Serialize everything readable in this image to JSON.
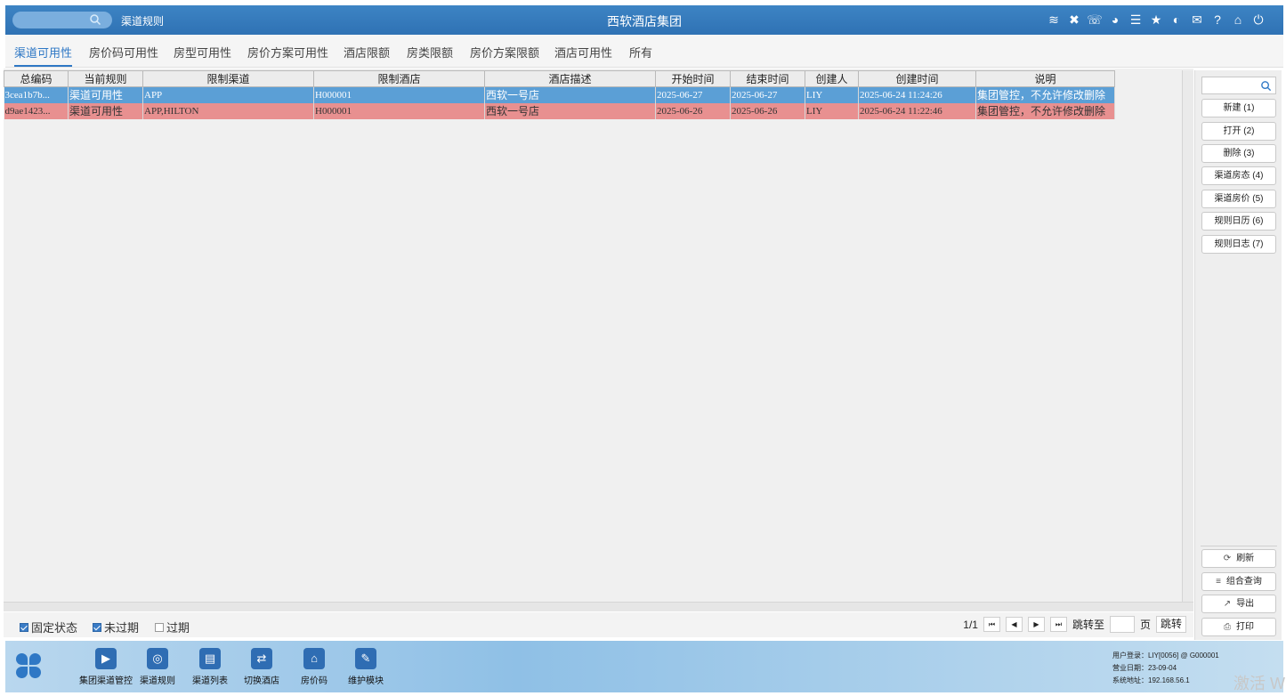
{
  "topbar": {
    "search_placeholder": "",
    "breadcrumb": "渠道规则",
    "system_title": "西软酒店集团",
    "icons": [
      "wifi-icon",
      "tools-icon",
      "phone-icon",
      "palette-icon",
      "menu-icon",
      "star-icon",
      "contrast-icon",
      "mail-icon",
      "help-icon",
      "home-icon",
      "power-icon"
    ]
  },
  "tabs": [
    "渠道可用性",
    "房价码可用性",
    "房型可用性",
    "房价方案可用性",
    "酒店限额",
    "房类限额",
    "房价方案限额",
    "酒店可用性",
    "所有"
  ],
  "grid": {
    "columns": [
      "总编码",
      "当前规则",
      "限制渠道",
      "限制酒店",
      "酒店描述",
      "开始时间",
      "结束时间",
      "创建人",
      "创建时间",
      "说明"
    ],
    "rows": [
      [
        "3cea1b7b...",
        "渠道可用性",
        "APP",
        "H000001",
        "西软一号店",
        "2025-06-27",
        "2025-06-27",
        "LIY",
        "2025-06-24 11:24:26",
        "集团管控，不允许修改删除"
      ],
      [
        "d9ae1423...",
        "渠道可用性",
        "APP,HILTON",
        "H000001",
        "西软一号店",
        "2025-06-26",
        "2025-06-26",
        "LIY",
        "2025-06-24 11:22:46",
        "集团管控，不允许修改删除"
      ]
    ]
  },
  "sidebar": {
    "search_placeholder": "",
    "buttons": [
      "新建 (1)",
      "打开 (2)",
      "删除 (3)",
      "渠道房态 (4)",
      "渠道房价 (5)",
      "规则日历 (6)",
      "规则日志 (7)"
    ],
    "bottom_buttons": [
      {
        "icon": "refresh-icon",
        "glyph": "⟳",
        "label": "刷新"
      },
      {
        "icon": "list-icon",
        "glyph": "≡",
        "label": "组合查询"
      },
      {
        "icon": "export-icon",
        "glyph": "↗",
        "label": "导出"
      },
      {
        "icon": "print-icon",
        "glyph": "⎙",
        "label": "打印"
      }
    ]
  },
  "filters": {
    "fixed_state": "固定状态",
    "not_expired": "未过期",
    "expired": "过期"
  },
  "pager": {
    "page": "1/1",
    "jump_to": "跳转至",
    "page_unit": "页",
    "jump": "跳转"
  },
  "modules": [
    "集团渠道管控",
    "渠道规则",
    "渠道列表",
    "切换酒店",
    "房价码",
    "维护模块"
  ],
  "info": {
    "user": "用户登录：LIY[0056] @ G000001",
    "biz_date": "营业日期：23-09-04",
    "address": "系统地址：192.168.56.1"
  },
  "watermark": "激活 W"
}
